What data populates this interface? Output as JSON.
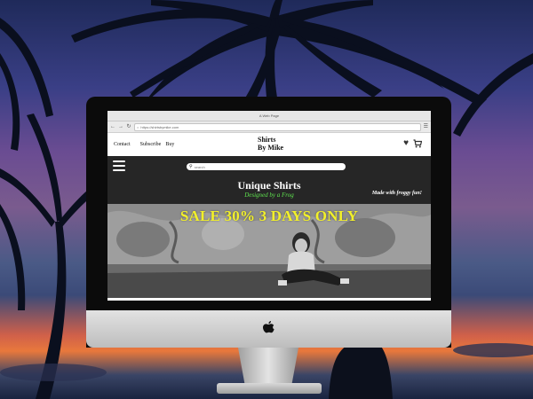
{
  "browser": {
    "title": "A Web Page",
    "url": "https://shirtsbymike.com",
    "back_icon": "arrow-left-icon",
    "forward_icon": "arrow-right-icon",
    "reload_icon": "reload-icon",
    "menu_icon": "hamburger-icon"
  },
  "site": {
    "nav": [
      "Contact",
      "Subscribe",
      "Buy"
    ],
    "logo_line1": "Shirts",
    "logo_line2": "By Mike",
    "heart_icon": "heart-icon",
    "cart_icon": "cart-icon",
    "search_placeholder": "search",
    "brand_title": "Unique Shirts",
    "brand_subtitle": "Designed by a Frog",
    "tagline": "Made with froggy fun!",
    "banner": "SALE 30% 3 DAYS ONLY"
  },
  "colors": {
    "dark_band": "#262626",
    "subtitle_green": "#5fe24f",
    "banner_yellow": "#f2f02a"
  }
}
